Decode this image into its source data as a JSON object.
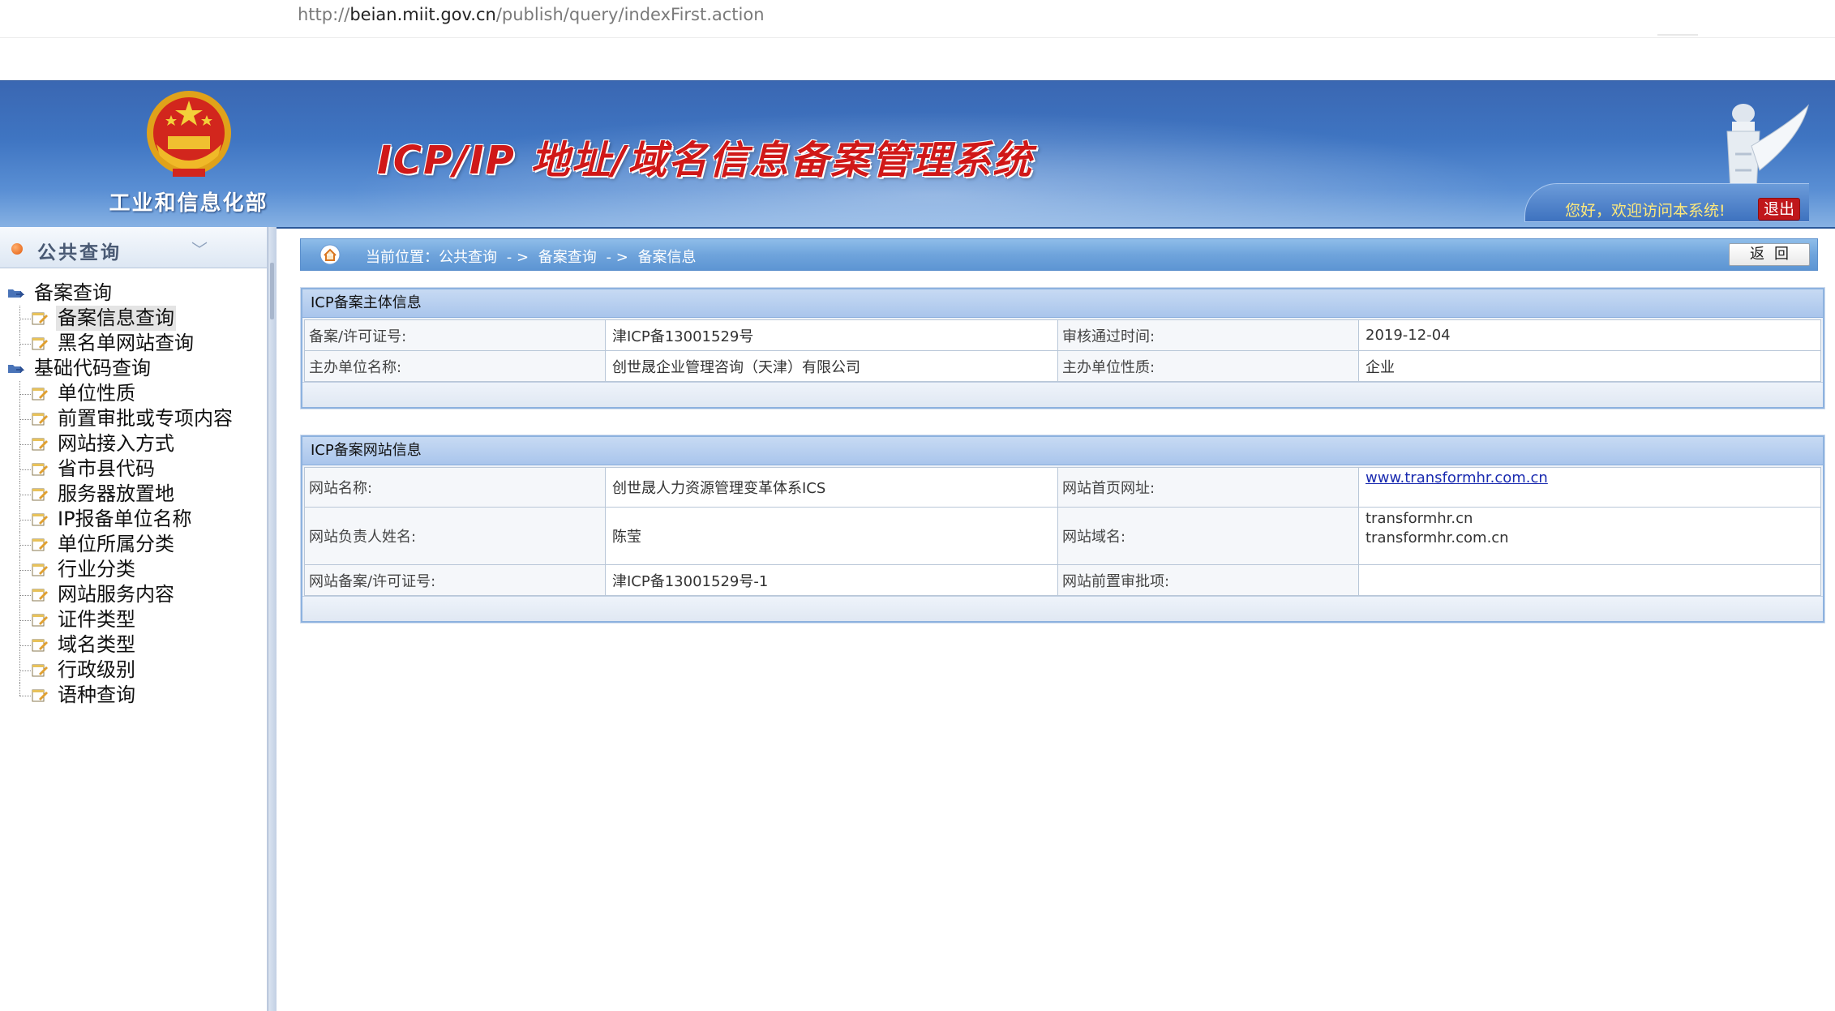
{
  "browser": {
    "url_scheme": "http://",
    "url_host": "beian.miit.gov.cn",
    "url_path": "/publish/query/indexFirst.action"
  },
  "banner": {
    "ministry": "工业和信息化部",
    "title": "ICP/IP 地址/域名信息备案管理系统",
    "welcome": "您好，欢迎访问本系统!",
    "logout": "退出",
    "colors": {
      "banner_blue": "#3f75c2",
      "title_red": "#d01818",
      "logout_red": "#c0171b"
    }
  },
  "sidebar": {
    "header": "公共查询",
    "groups": [
      {
        "label": "备案查询",
        "items": [
          {
            "label": "备案信息查询",
            "selected": true
          },
          {
            "label": "黑名单网站查询"
          }
        ]
      },
      {
        "label": "基础代码查询",
        "items": [
          {
            "label": "单位性质"
          },
          {
            "label": "前置审批或专项内容"
          },
          {
            "label": "网站接入方式"
          },
          {
            "label": "省市县代码"
          },
          {
            "label": "服务器放置地"
          },
          {
            "label": "IP报备单位名称"
          },
          {
            "label": "单位所属分类"
          },
          {
            "label": "行业分类"
          },
          {
            "label": "网站服务内容"
          },
          {
            "label": "证件类型"
          },
          {
            "label": "域名类型"
          },
          {
            "label": "行政级别"
          },
          {
            "label": "语种查询"
          }
        ]
      }
    ]
  },
  "breadcrumb": {
    "prefix": "当前位置：公共查询",
    "sep": "- >",
    "level2": "备案查询",
    "level3": "备案信息",
    "back_button": "返回"
  },
  "subject_panel": {
    "title": "ICP备案主体信息",
    "rows": [
      {
        "l1": "备案/许可证号:",
        "v1": "津ICP备13001529号",
        "l2": "审核通过时间:",
        "v2": "2019-12-04"
      },
      {
        "l1": "主办单位名称:",
        "v1": "创世晟企业管理咨询（天津）有限公司",
        "l2": "主办单位性质:",
        "v2": "企业"
      }
    ]
  },
  "site_panel": {
    "title": "ICP备案网站信息",
    "site_name_label": "网站名称:",
    "site_name": "创世晟人力资源管理变革体系ICS",
    "homepage_label": "网站首页网址:",
    "homepage": "www.transformhr.com.cn",
    "owner_label": "网站负责人姓名:",
    "owner": "陈莹",
    "domain_label": "网站域名:",
    "domain1": "transformhr.cn",
    "domain2": "transformhr.com.cn",
    "license_label": "网站备案/许可证号:",
    "license": "津ICP备13001529号-1",
    "preapproval_label": "网站前置审批项:",
    "preapproval": ""
  }
}
